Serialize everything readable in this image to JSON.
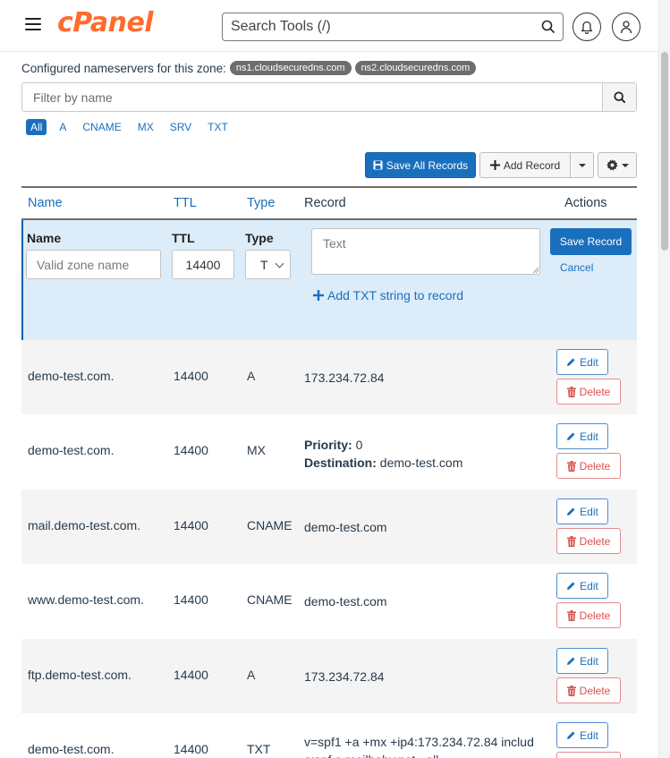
{
  "header": {
    "logo": "cPanel",
    "search_placeholder": "Search Tools (/)"
  },
  "nameservers": {
    "label": "Configured nameservers for this zone:",
    "servers": [
      "ns1.cloudsecuredns.com",
      "ns2.cloudsecuredns.com"
    ]
  },
  "filter": {
    "placeholder": "Filter by name"
  },
  "type_tabs": [
    "All",
    "A",
    "CNAME",
    "MX",
    "SRV",
    "TXT"
  ],
  "toolbar": {
    "save_all_label": "Save All Records",
    "add_record_label": "Add Record"
  },
  "table": {
    "headers": {
      "name": "Name",
      "ttl": "TTL",
      "type": "Type",
      "record": "Record",
      "actions": "Actions"
    }
  },
  "add_form": {
    "name_label": "Name",
    "ttl_label": "TTL",
    "type_label": "Type",
    "name_placeholder": "Valid zone name",
    "ttl_value": "14400",
    "type_value": "T",
    "text_placeholder": "Text",
    "add_txt_label": "Add TXT string to record",
    "save_label": "Save Record",
    "cancel_label": "Cancel"
  },
  "actions": {
    "edit_label": "Edit",
    "delete_label": "Delete"
  },
  "records": [
    {
      "name": "demo-test.com.",
      "ttl": "14400",
      "type": "A",
      "record": "173.234.72.84"
    },
    {
      "name": "demo-test.com.",
      "ttl": "14400",
      "type": "MX",
      "priority_label": "Priority:",
      "priority": "0",
      "destination_label": "Destination:",
      "destination": "demo-test.com"
    },
    {
      "name": "mail.demo-test.com.",
      "ttl": "14400",
      "type": "CNAME",
      "record": "demo-test.com"
    },
    {
      "name": "www.demo-test.com.",
      "ttl": "14400",
      "type": "CNAME",
      "record": "demo-test.com"
    },
    {
      "name": "ftp.demo-test.com.",
      "ttl": "14400",
      "type": "A",
      "record": "173.234.72.84"
    },
    {
      "name": "demo-test.com.",
      "ttl": "14400",
      "type": "TXT",
      "record_line1": "v=spf1 +a +mx +ip4:173.234.72.84 includ",
      "record_line2": "e:spf.e.mailbaby.net ~all"
    }
  ],
  "colors": {
    "brand": "#ff6c2c",
    "primary": "#1a6fbd",
    "danger": "#d9534f",
    "form_bg": "#dcecf9"
  }
}
